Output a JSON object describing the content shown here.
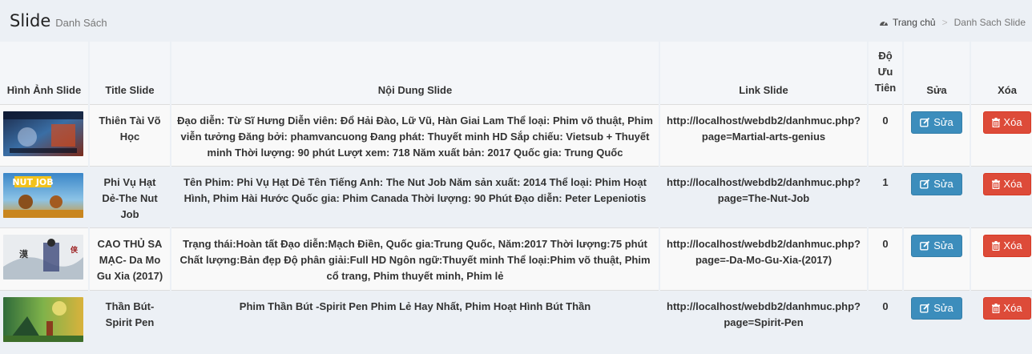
{
  "header": {
    "title": "Slide",
    "subtitle": "Danh Sách"
  },
  "breadcrumb": {
    "home": "Trang chủ",
    "current": "Danh Sach Slide"
  },
  "table": {
    "columns": {
      "image": "Hình Ảnh Slide",
      "title": "Title Slide",
      "content": "Nội Dung Slide",
      "link": "Link Slide",
      "priority": "Độ Ưu Tiên",
      "edit": "Sửa",
      "delete": "Xóa"
    },
    "rows": [
      {
        "title": "Thiên Tài Võ Học",
        "content": "Đạo diễn: Từ Sĩ Hưng Diễn viên: Đổ Hải Đào, Lữ Vũ, Hàn Giai Lam Thể loại: Phim võ thuật, Phim viễn tưởng Đăng bởi: phamvancuong Đang phát: Thuyết minh HD Sắp chiếu: Vietsub + Thuyết minh Thời lượng: 90 phút Lượt xem: 718 Năm xuất bản: 2017 Quốc gia: Trung Quốc",
        "link": "http://localhost/webdb2/danhmuc.php?page=Martial-arts-genius",
        "priority": "0",
        "edit_label": "Sửa",
        "delete_label": "Xóa"
      },
      {
        "title": "Phi Vụ Hạt Dẻ-The Nut Job",
        "content": "Tên Phim: Phi Vụ Hạt Dẻ Tên Tiếng Anh: The Nut Job Năm sản xuất: 2014 Thể loại: Phim Hoạt Hình, Phim Hài Hước Quốc gia: Phim Canada Thời lượng: 90 Phút Đạo diễn: Peter Lepeniotis",
        "link": "http://localhost/webdb2/danhmuc.php?page=The-Nut-Job",
        "priority": "1",
        "edit_label": "Sửa",
        "delete_label": "Xóa"
      },
      {
        "title": "CAO THỦ SA MẠC- Da Mo Gu Xia (2017)",
        "content": "Trạng thái:Hoàn tất Đạo diễn:Mạch Điền, Quốc gia:Trung Quốc, Năm:2017 Thời lượng:75 phút Chất lượng:Bản đẹp Độ phân giải:Full HD Ngôn ngữ:Thuyết minh Thể loại:Phim võ thuật, Phim cổ trang, Phim thuyết minh, Phim lẻ",
        "link": "http://localhost/webdb2/danhmuc.php?page=-Da-Mo-Gu-Xia-(2017)",
        "priority": "0",
        "edit_label": "Sửa",
        "delete_label": "Xóa"
      },
      {
        "title": "Thần Bút-Spirit Pen",
        "content": "Phim Thần Bút -Spirit Pen Phim Lẻ Hay Nhất, Phim Hoạt Hình Bút Thần",
        "link": "http://localhost/webdb2/danhmuc.php?page=Spirit-Pen",
        "priority": "0",
        "edit_label": "Sửa",
        "delete_label": "Xóa"
      }
    ]
  },
  "colors": {
    "edit": "#3c8dbc",
    "delete": "#dd4b39"
  },
  "icons": {
    "home": "dashboard-icon",
    "edit": "edit-icon",
    "delete": "trash-icon"
  }
}
